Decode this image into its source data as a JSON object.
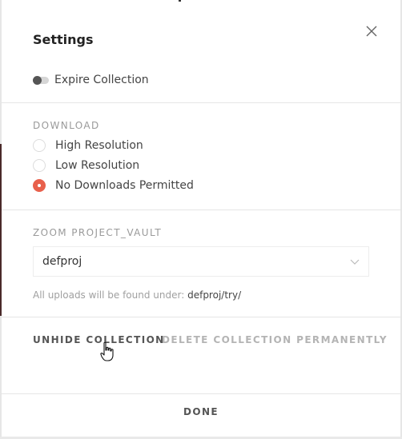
{
  "modal": {
    "title": "Settings",
    "close_icon": "close-icon"
  },
  "expire": {
    "label": "Expire Collection",
    "enabled": false
  },
  "download": {
    "heading": "DOWNLOAD",
    "options": [
      {
        "label": "High Resolution",
        "selected": false
      },
      {
        "label": "Low Resolution",
        "selected": false
      },
      {
        "label": "No Downloads Permitted",
        "selected": true
      }
    ]
  },
  "zoom": {
    "heading": "ZOOM PROJECT_VAULT",
    "selected_value": "defproj",
    "hint_prefix": "All uploads will be found under:",
    "hint_path": "defproj/try/"
  },
  "actions": {
    "unhide_label": "UNHIDE COLLECTION",
    "delete_label": "DELETE COLLECTION PERMANENTLY"
  },
  "footer": {
    "done_label": "DONE"
  },
  "colors": {
    "accent": "#e8604c"
  }
}
